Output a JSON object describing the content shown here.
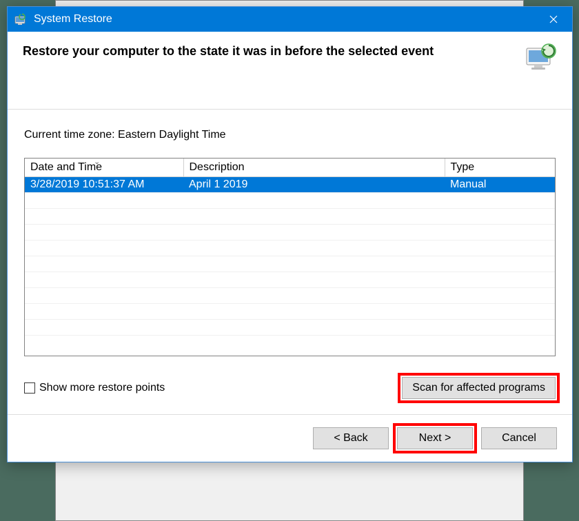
{
  "window": {
    "title": "System Restore"
  },
  "header": {
    "heading": "Restore your computer to the state it was in before the selected event"
  },
  "timezone_label": "Current time zone: Eastern Daylight Time",
  "table": {
    "columns": {
      "date": "Date and Time",
      "desc": "Description",
      "type": "Type"
    },
    "rows": [
      {
        "date": "3/28/2019 10:51:37 AM",
        "desc": "April 1 2019",
        "type": "Manual",
        "selected": true
      }
    ]
  },
  "show_more": {
    "label": "Show more restore points",
    "checked": false
  },
  "scan_button": "Scan for affected programs",
  "footer": {
    "back": "< Back",
    "next": "Next >",
    "cancel": "Cancel"
  }
}
